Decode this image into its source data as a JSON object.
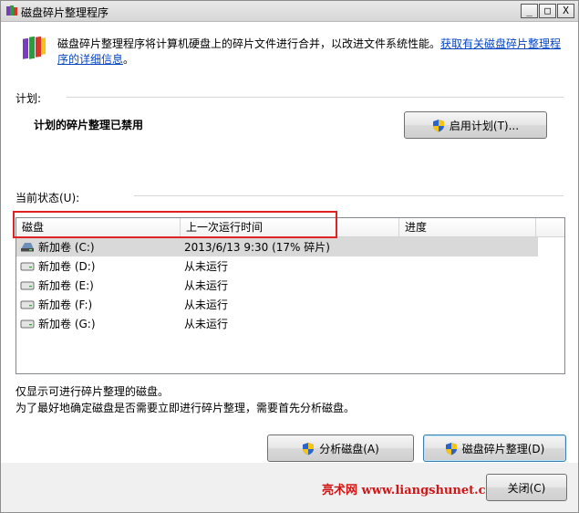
{
  "window": {
    "title": "磁盘碎片整理程序",
    "controls": {
      "minimize": "_",
      "maximize": "□",
      "close": "X"
    }
  },
  "intro": {
    "text": "磁盘碎片整理程序将计算机硬盘上的碎片文件进行合并，以改进文件系统性能。",
    "link": "获取有关磁盘碎片整理程序的详细信息",
    "end": "。"
  },
  "schedule": {
    "label": "计划:",
    "status": "计划的碎片整理已禁用",
    "enable_button": "启用计划(T)..."
  },
  "current": {
    "label": "当前状态(U):",
    "columns": [
      "磁盘",
      "上一次运行时间",
      "进度"
    ],
    "rows": [
      {
        "disk": "新加卷 (C:)",
        "last_run": "2013/6/13 9:30 (17% 碎片)",
        "progress": "",
        "selected": true
      },
      {
        "disk": "新加卷 (D:)",
        "last_run": "从未运行",
        "progress": ""
      },
      {
        "disk": "新加卷 (E:)",
        "last_run": "从未运行",
        "progress": ""
      },
      {
        "disk": "新加卷 (F:)",
        "last_run": "从未运行",
        "progress": ""
      },
      {
        "disk": "新加卷 (G:)",
        "last_run": "从未运行",
        "progress": ""
      }
    ]
  },
  "notes": {
    "line1": "仅显示可进行碎片整理的磁盘。",
    "line2": "为了最好地确定磁盘是否需要立即进行碎片整理，需要首先分析磁盘。"
  },
  "actions": {
    "analyze": "分析磁盘(A)",
    "defrag": "磁盘碎片整理(D)",
    "close": "关闭(C)"
  },
  "watermark": "亮术网 www.liangshunet.com",
  "colors": {
    "link": "#0645c4",
    "highlight": "#e02222",
    "watermark": "#d01616"
  }
}
